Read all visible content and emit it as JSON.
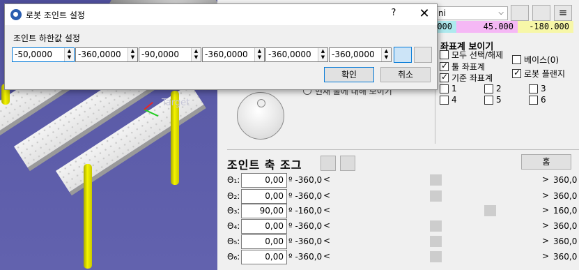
{
  "dialog": {
    "title": "로봇 조인트 설정",
    "help": "?",
    "close": "✕",
    "section_label": "조인트 하한값 설정",
    "fields": [
      "-50,0000",
      "-360,0000",
      "-90,0000",
      "-360,0000",
      "-360,0000",
      "-360,0000"
    ],
    "ok_label": "확인",
    "cancel_label": "취소"
  },
  "viewport": {
    "target_label": "Target"
  },
  "top": {
    "combo_value": "ni",
    "coords": [
      "000",
      "45.000",
      "-180.000"
    ]
  },
  "coord_display": {
    "title": "좌표계 보이기",
    "items": [
      {
        "label": "모두 선택/해제",
        "checked": false
      },
      {
        "label": "툴 좌표계",
        "checked": true
      },
      {
        "label": "기준 좌표계",
        "checked": true
      },
      {
        "label": "베이스(0)",
        "checked": false
      },
      {
        "label": "로봇 플랜지",
        "checked": true
      }
    ],
    "joints": [
      {
        "label": "1",
        "checked": false
      },
      {
        "label": "2",
        "checked": false
      },
      {
        "label": "3",
        "checked": false
      },
      {
        "label": "4",
        "checked": false
      },
      {
        "label": "5",
        "checked": false
      },
      {
        "label": "6",
        "checked": false
      }
    ]
  },
  "radio_label": "현재 툴에 대해 보이기",
  "jog": {
    "title": "조인트 축 조그",
    "home_label": "홈",
    "rows": [
      {
        "sym": "Θ₁:",
        "value": "0,00",
        "min": "º -360,0",
        "max": "360,0",
        "pos": 0.5
      },
      {
        "sym": "Θ₂:",
        "value": "0,00",
        "min": "º -360,0",
        "max": "360,0",
        "pos": 0.5
      },
      {
        "sym": "Θ₃:",
        "value": "90,00",
        "min": "º -160,0",
        "max": "160,0",
        "pos": 0.78
      },
      {
        "sym": "Θ₄:",
        "value": "0,00",
        "min": "º -360,0",
        "max": "360,0",
        "pos": 0.5
      },
      {
        "sym": "Θ₅:",
        "value": "0,00",
        "min": "º -360,0",
        "max": "360,0",
        "pos": 0.5
      },
      {
        "sym": "Θ₆:",
        "value": "0,00",
        "min": "º -360,0",
        "max": "360,0",
        "pos": 0.5
      }
    ],
    "lt": "<",
    "gt": ">"
  },
  "colors": {
    "coord_x_bg": "#aee9ee",
    "coord_y_bg": "#f5b8f5",
    "coord_z_bg": "#f7f7a8"
  }
}
